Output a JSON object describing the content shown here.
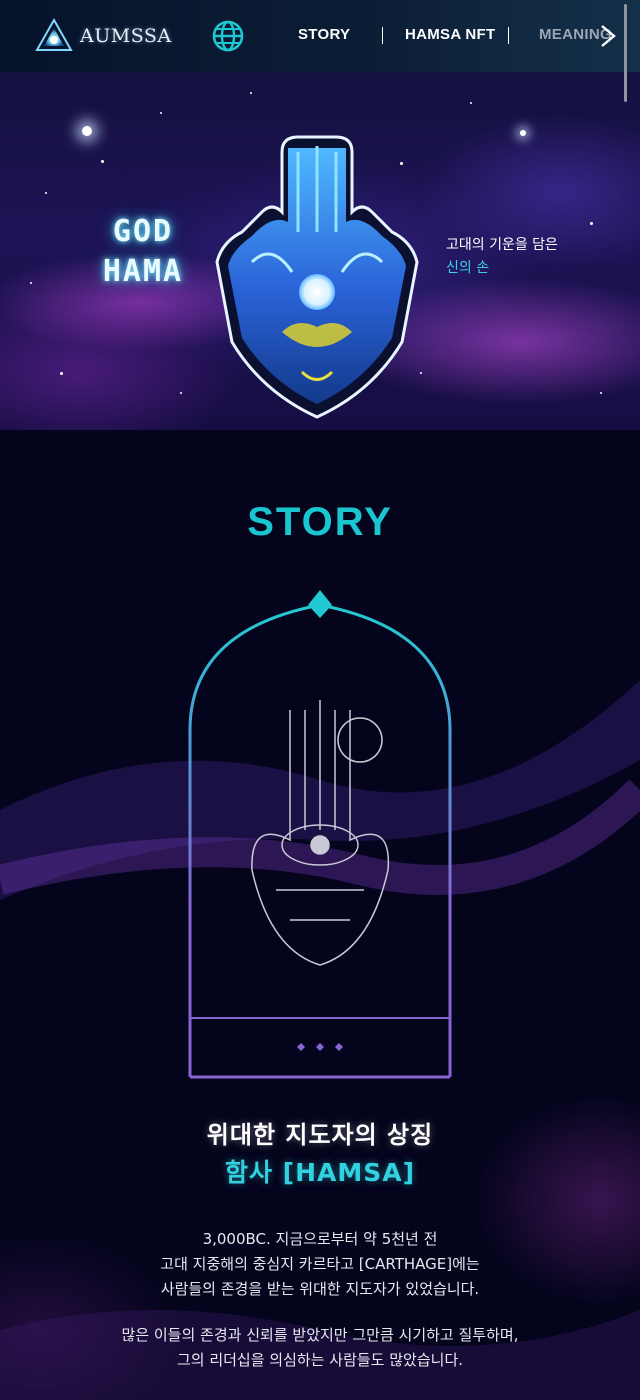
{
  "header": {
    "logo_text": "AUMSSA",
    "menu": [
      {
        "label": "STORY"
      },
      {
        "label": "HAMSA NFT"
      },
      {
        "label": "MEANING"
      }
    ]
  },
  "hero": {
    "title_line1": "GOD",
    "title_line2": "HAMA",
    "tagline_line1": "고대의 기운을 담은",
    "tagline_line2": "신의 손"
  },
  "story": {
    "title": "STORY",
    "heading_line1": "위대한 지도자의 상징",
    "heading_line2": "함사 [HAMSA]",
    "paragraph1": [
      "3,000BC. 지금으로부터 약 5천년 전",
      "고대 지중해의 중심지 카르타고 [CARTHAGE]에는",
      "사람들의 존경을 받는 위대한 지도자가 있었습니다."
    ],
    "paragraph2": [
      "많은 이들의 존경과 신뢰를 받았지만 그만큼 시기하고 질투하며,",
      "그의 리더십을 의심하는 사람들도 많았습니다."
    ]
  },
  "colors": {
    "accent_teal": "#19c6cf",
    "tagline_teal": "#3fd1e6",
    "frame_purple": "#8a63d2",
    "background": "#04041c"
  },
  "icons": {
    "globe": "globe-icon",
    "next": "chevron-right-icon",
    "logo": "triangle-logo-icon"
  }
}
